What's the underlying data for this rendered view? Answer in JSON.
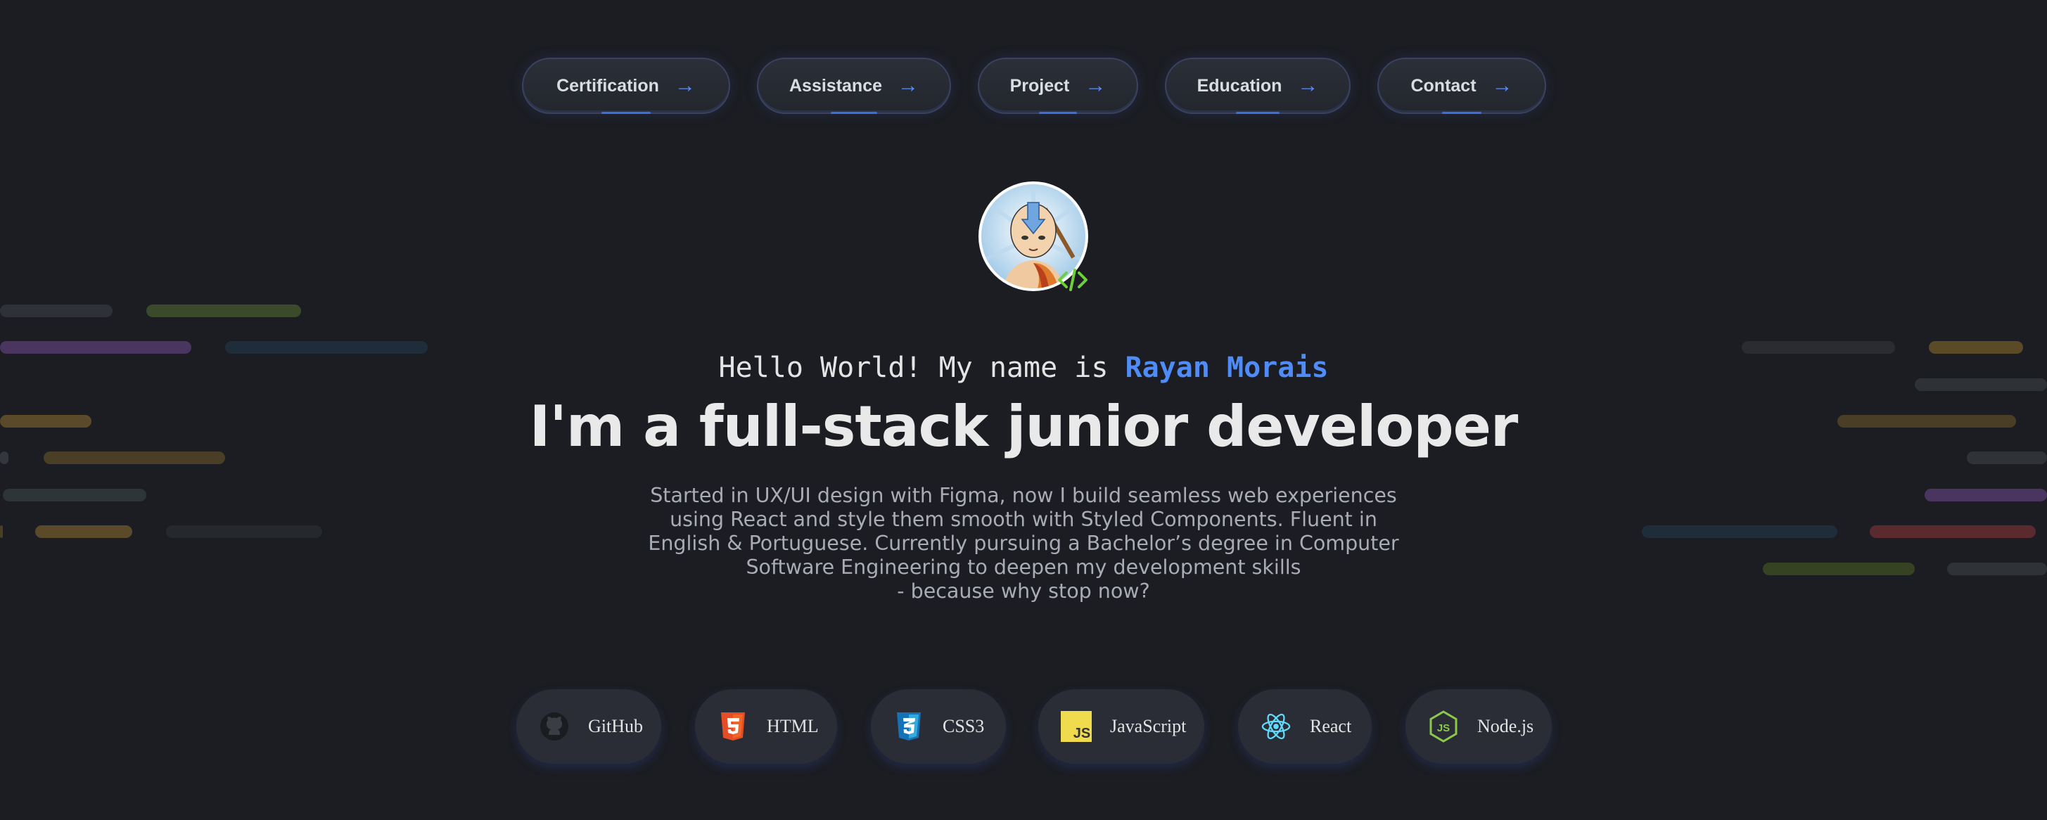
{
  "nav": {
    "items": [
      {
        "label": "Certification"
      },
      {
        "label": "Assistance"
      },
      {
        "label": "Project"
      },
      {
        "label": "Education"
      },
      {
        "label": "Contact"
      }
    ]
  },
  "hero": {
    "greeting": "Hello World! My name is",
    "name": "Rayan Morais",
    "headline": "I'm a full-stack junior developer",
    "description_lines": [
      "Started in UX/UI design with Figma, now I build seamless web experiences",
      "using React and style them smooth with Styled Components. Fluent in",
      "English & Portuguese. Currently pursuing a Bachelor’s degree in Computer",
      "Software Engineering to deepen my development skills",
      "- because why stop now?"
    ]
  },
  "skills": [
    {
      "label": "GitHub",
      "icon": "github-icon"
    },
    {
      "label": "HTML",
      "icon": "html5-icon"
    },
    {
      "label": "CSS3",
      "icon": "css3-icon"
    },
    {
      "label": "JavaScript",
      "icon": "javascript-icon"
    },
    {
      "label": "React",
      "icon": "react-icon"
    },
    {
      "label": "Node.js",
      "icon": "nodejs-icon"
    }
  ],
  "colors": {
    "background": "#1b1d22",
    "accent": "#4f8cf7",
    "button": "#2a2d35"
  }
}
